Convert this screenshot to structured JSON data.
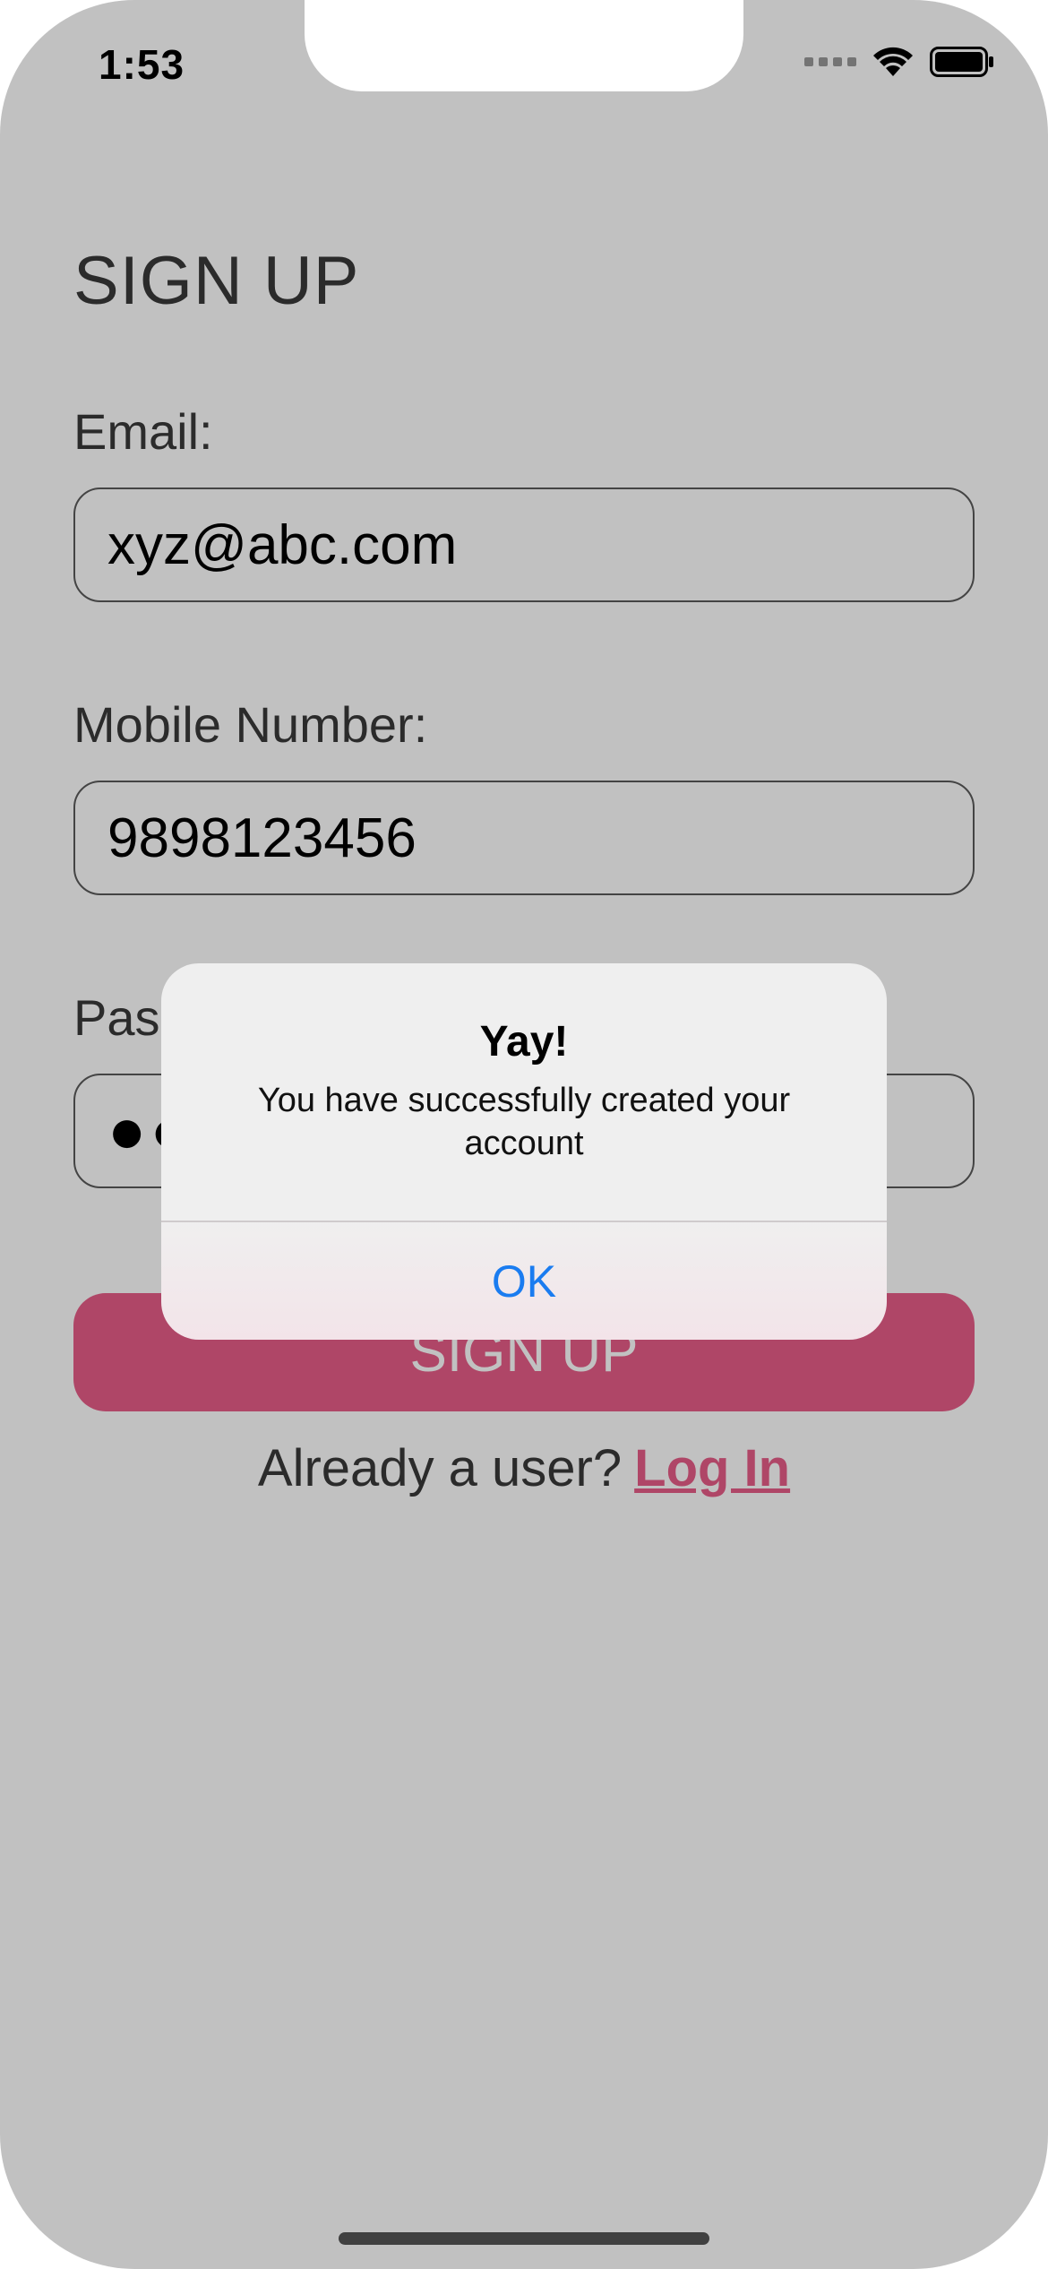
{
  "status_bar": {
    "time": "1:53"
  },
  "signup_form": {
    "title": "SIGN UP",
    "email_label": "Email:",
    "email_value": "xyz@abc.com",
    "mobile_label": "Mobile Number:",
    "mobile_value": "9898123456",
    "password_label_visible": "Pas",
    "password_value_visible": "●●",
    "submit_label": "SIGN UP",
    "login_prompt": "Already a user?",
    "login_link": "Log In"
  },
  "alert": {
    "title": "Yay!",
    "message": "You have successfully created your account",
    "ok_label": "OK"
  },
  "colors": {
    "accent": "#e85d88",
    "dimmed_accent": "#bd486b",
    "link_blue": "#1a7cf0",
    "dimmed_background": "#c1c1c1"
  },
  "icons": [
    "signal-dots-icon",
    "wifi-icon",
    "battery-icon"
  ]
}
